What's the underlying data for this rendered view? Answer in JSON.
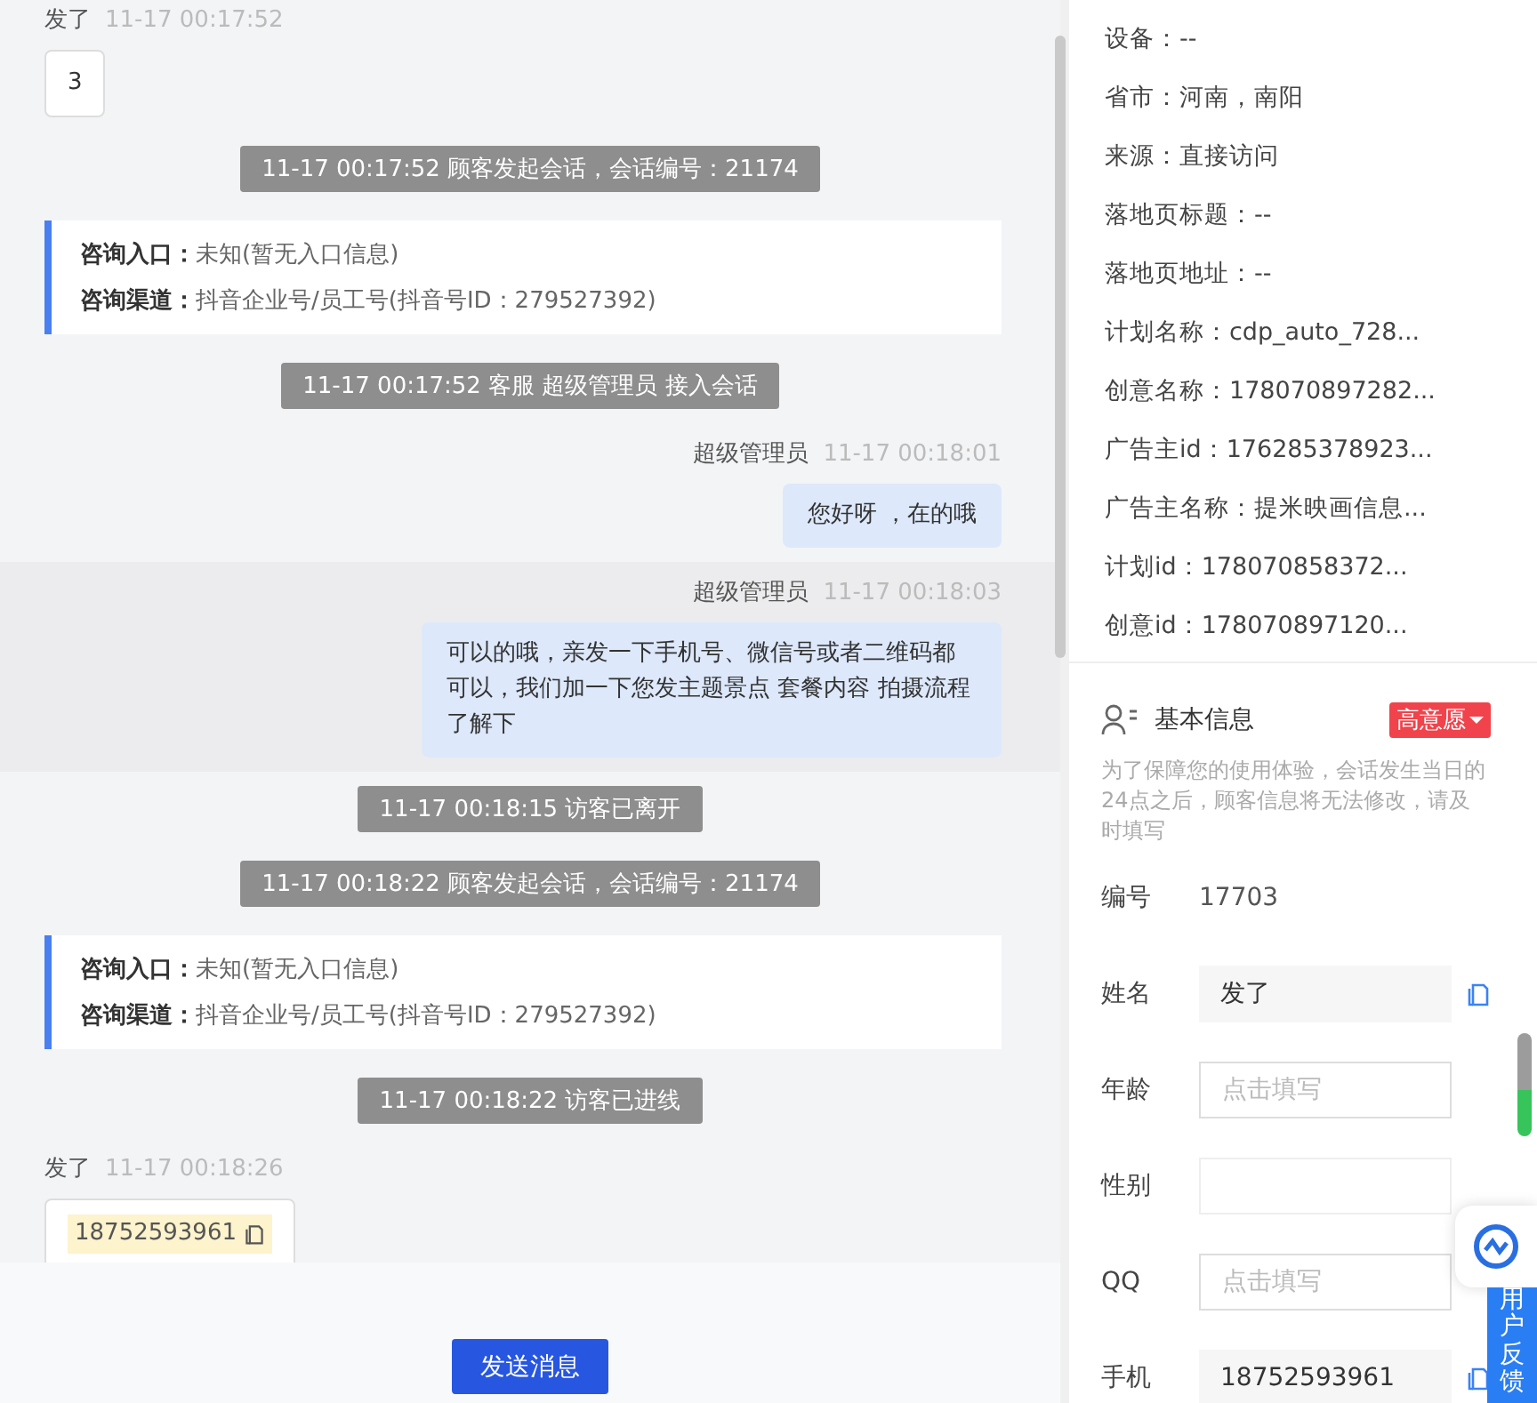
{
  "chat": {
    "messages": [
      {
        "kind": "customer_text",
        "sender": "发了",
        "time": "11-17 00:17:52",
        "text": "3"
      },
      {
        "kind": "system",
        "text": "11-17 00:17:52 顾客发起会话，会话编号：21174"
      },
      {
        "kind": "info",
        "lines": [
          {
            "label": "咨询入口：",
            "value": "未知(暂无入口信息)"
          },
          {
            "label": "咨询渠道：",
            "value": "抖音企业号/员工号(抖音号ID：279527392)"
          }
        ]
      },
      {
        "kind": "system",
        "text": "11-17 00:17:52 客服 超级管理员 接入会话"
      },
      {
        "kind": "agent",
        "sender": "超级管理员",
        "time": "11-17 00:18:01",
        "text": "您好呀 ，在的哦",
        "highlighted": false
      },
      {
        "kind": "agent",
        "sender": "超级管理员",
        "time": "11-17 00:18:03",
        "text": "可以的哦，亲发一下手机号、微信号或者二维码都可以，我们加一下您发主题景点 套餐内容 拍摄流程了解下",
        "highlighted": true
      },
      {
        "kind": "system",
        "text": "11-17 00:18:15 访客已离开"
      },
      {
        "kind": "system",
        "text": "11-17 00:18:22 顾客发起会话，会话编号：21174"
      },
      {
        "kind": "info",
        "lines": [
          {
            "label": "咨询入口：",
            "value": "未知(暂无入口信息)"
          },
          {
            "label": "咨询渠道：",
            "value": "抖音企业号/员工号(抖音号ID：279527392)"
          }
        ]
      },
      {
        "kind": "system",
        "text": "11-17 00:18:22 访客已进线"
      },
      {
        "kind": "customer_phone",
        "sender": "发了",
        "time": "11-17 00:18:26",
        "text": "18752593961"
      }
    ]
  },
  "send_button": "发送消息",
  "visitor_info": [
    "设备：--",
    "省市：河南，南阳",
    "来源：直接访问",
    "落地页标题：--",
    "落地页地址：--",
    "计划名称：cdp_auto_728...",
    "创意名称：178070897282...",
    "广告主id：176285378923...",
    "广告主名称：提米映画信息...",
    "计划id：178070858372...",
    "创意id：178070897120..."
  ],
  "basic_info": {
    "title": "基本信息",
    "tag": "高意愿",
    "note": "为了保障您的使用体验，会话发生当日的24点之后，顾客信息将无法修改，请及时填写",
    "fields": [
      {
        "label": "编号",
        "kind": "static",
        "value": "17703"
      },
      {
        "label": "姓名",
        "kind": "filled",
        "value": "发了",
        "copyable": true
      },
      {
        "label": "年龄",
        "kind": "input",
        "placeholder": "点击填写"
      },
      {
        "label": "性别",
        "kind": "empty"
      },
      {
        "label": "QQ",
        "kind": "input",
        "placeholder": "点击填写"
      },
      {
        "label": "手机",
        "kind": "filled",
        "value": "18752593961",
        "copyable": true
      }
    ]
  },
  "feedback_tab": "用户反馈"
}
